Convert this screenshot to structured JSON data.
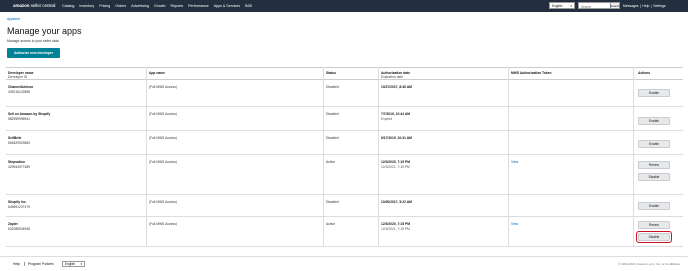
{
  "nav": {
    "logo_brand": "amazon",
    "logo_product": "seller central",
    "links": [
      "Catalog",
      "Inventory",
      "Pricing",
      "Orders",
      "Advertising",
      "Growth",
      "Reports",
      "Performance",
      "Apps & Services",
      "B2B"
    ],
    "language": "English",
    "search_placeholder": "Search",
    "search_button": "Search",
    "right_links": [
      "Messages",
      "|",
      "Help",
      "|",
      "Settings"
    ]
  },
  "page": {
    "breadcrumb": "Appstore",
    "title": "Manage your apps",
    "subtitle": "Manage access to your seller data",
    "authorize_button": "Authorize new developer"
  },
  "table": {
    "headers": {
      "developer_name": "Developer name",
      "developer_id": "Developer ID",
      "app_name": "App name",
      "status": "Status",
      "auth_date": "Authorization date",
      "expiration_date": "Expiration date",
      "mws_token": "MWS Authorization Token",
      "actions": "Actions"
    },
    "rows": [
      {
        "name": "ChannelAdvisor",
        "id": "439216122898",
        "app": "(Full MWS Access)",
        "status": "Disabled",
        "date": "10/27/2017, 8:36 AM",
        "expiration": "",
        "mws": "",
        "actions": [
          "Enable"
        ]
      },
      {
        "name": "Sell on Amazon by Shopify",
        "id": "582959995941",
        "app": "(Full MWS Access)",
        "status": "Disabled",
        "date": "7/7/2019, 10:44 AM",
        "expiration": "Expired",
        "mws": "",
        "actions": [
          "Enable"
        ]
      },
      {
        "name": "SellBrite",
        "id": "694829923563",
        "app": "(Full MWS Access)",
        "status": "Disabled",
        "date": "8/17/2019, 10:31 AM",
        "expiration": "",
        "mws": "",
        "actions": [
          "Enable"
        ]
      },
      {
        "name": "Stepsation",
        "id": "429944977489",
        "app": "(Full MWS Access)",
        "status": "Active",
        "date": "12/3/2020, 7:15 PM",
        "expiration": "12/3/2021, 7:15 PM",
        "mws": "View",
        "actions": [
          "Renew",
          "Disable"
        ]
      },
      {
        "name": "Shopify Inc.",
        "id": "649691227479",
        "app": "(Full MWS Access)",
        "status": "Disabled",
        "date": "10/30/2017, 5:22 AM",
        "expiration": "",
        "mws": "",
        "actions": [
          "Enable"
        ]
      },
      {
        "name": "Zapier",
        "id": "632285934945",
        "app": "(Full MWS Access)",
        "status": "Active",
        "date": "12/3/2020, 7:15 PM",
        "expiration": "12/3/2021, 7:15 PM",
        "mws": "View",
        "actions": [
          "Renew",
          "Disable"
        ]
      }
    ]
  },
  "footer": {
    "help": "Help",
    "policies": "Program Policies",
    "language": "English",
    "copyright": "© 1999-2020, Amazon.com, Inc. or its affiliates"
  },
  "colors": {
    "nav_bg": "#232f3e",
    "primary_button": "#008296",
    "link": "#0066c0",
    "highlight": "#cc1122"
  }
}
